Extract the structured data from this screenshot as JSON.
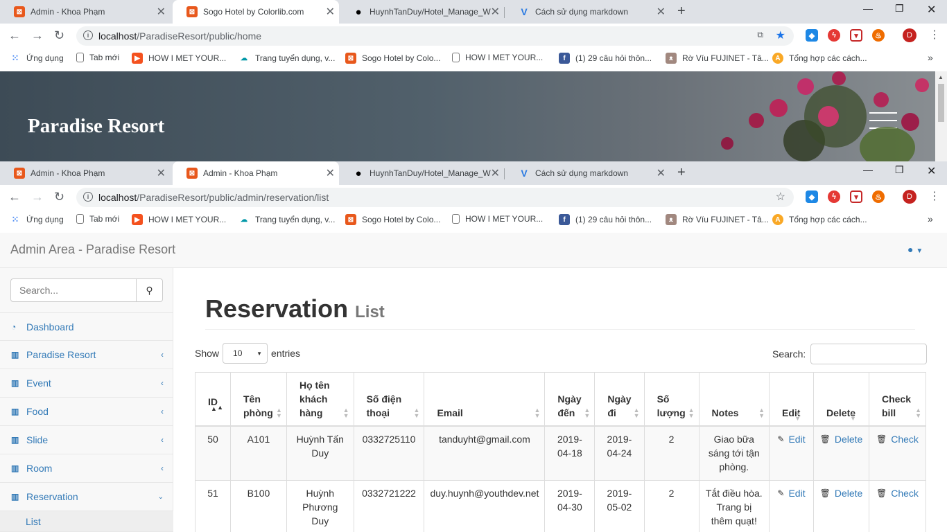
{
  "browser_back": {
    "tabs": [
      {
        "title": "Admin - Khoa Phạm",
        "fav": "X",
        "fav_color": "#e8581c"
      },
      {
        "title": "Sogo Hotel by Colorlib.com",
        "fav": "X",
        "fav_color": "#e8581c"
      },
      {
        "title": "HuynhTanDuy/Hotel_Manage_We",
        "fav": "●",
        "fav_color": "#000000"
      },
      {
        "title": "Cách sử dụng markdown",
        "fav": "V",
        "fav_color": "#2a7ae2"
      }
    ],
    "url_host": "localhost",
    "url_path": "/ParadiseResort/public/home"
  },
  "browser_front": {
    "tabs": [
      {
        "title": "Admin - Khoa Phạm",
        "fav": "X",
        "fav_color": "#e8581c"
      },
      {
        "title": "Admin - Khoa Phạm",
        "fav": "X",
        "fav_color": "#e8581c"
      },
      {
        "title": "HuynhTanDuy/Hotel_Manage_We",
        "fav": "●",
        "fav_color": "#000000"
      },
      {
        "title": "Cách sử dụng markdown",
        "fav": "V",
        "fav_color": "#2a7ae2"
      }
    ],
    "url_host": "localhost",
    "url_path": "/ParadiseResort/public/admin/reservation/list"
  },
  "bookmarks": [
    {
      "label": "Ứng dụng",
      "icon": "apps-icon"
    },
    {
      "label": "Tab mới",
      "icon": "page-icon"
    },
    {
      "label": "HOW I MET YOUR...",
      "icon": "video-icon"
    },
    {
      "label": "Trang tuyển dụng, v...",
      "icon": "cloud-icon"
    },
    {
      "label": "Sogo Hotel by Colo...",
      "icon": "xampp-icon"
    },
    {
      "label": "HOW I MET YOUR...",
      "icon": "page-icon"
    },
    {
      "label": "(1) 29 câu hỏi thôn...",
      "icon": "facebook-icon"
    },
    {
      "label": "Rờ Víu FUJINET - Tâ...",
      "icon": "cat-icon"
    },
    {
      "label": "Tổng hợp các cách...",
      "icon": "a-icon"
    }
  ],
  "avatar_letter": "D",
  "hero": {
    "title": "Paradise Resort"
  },
  "admin": {
    "brand": "Admin Area - Paradise Resort"
  },
  "sidebar": {
    "search_placeholder": "Search...",
    "items": [
      {
        "label": "Dashboard"
      },
      {
        "label": "Paradise Resort"
      },
      {
        "label": "Event"
      },
      {
        "label": "Food"
      },
      {
        "label": "Slide"
      },
      {
        "label": "Room"
      },
      {
        "label": "Reservation"
      }
    ],
    "sub_item": "List"
  },
  "page": {
    "title": "Reservation",
    "subtitle": "List",
    "show_label": "Show",
    "entries_value": "10",
    "entries_label": "entries",
    "search_label": "Search:"
  },
  "table": {
    "headers": [
      "ID",
      "Tên phòng",
      "Họ tên khách hàng",
      "Số điện thoại",
      "Email",
      "Ngày đến",
      "Ngày đi",
      "Số lượng",
      "Notes",
      "Edit",
      "Delete",
      "Check bill"
    ],
    "rows": [
      {
        "id": "50",
        "room": "A101",
        "name": "Huỳnh Tấn Duy",
        "phone": "0332725110",
        "email": "tanduyht@gmail.com",
        "arrive": "2019-04-18",
        "leave": "2019-04-24",
        "qty": "2",
        "notes": "Giao bữa sáng tới tận phòng.",
        "edit": "Edit",
        "delete": "Delete",
        "check": "Check"
      },
      {
        "id": "51",
        "room": "B100",
        "name": "Huỳnh Phương Duy",
        "phone": "0332721222",
        "email": "duy.huynh@youthdev.net",
        "arrive": "2019-04-30",
        "leave": "2019-05-02",
        "qty": "2",
        "notes": "Tắt điều hòa. Trang bị thêm quạt!",
        "edit": "Edit",
        "delete": "Delete",
        "check": "Check"
      }
    ]
  }
}
